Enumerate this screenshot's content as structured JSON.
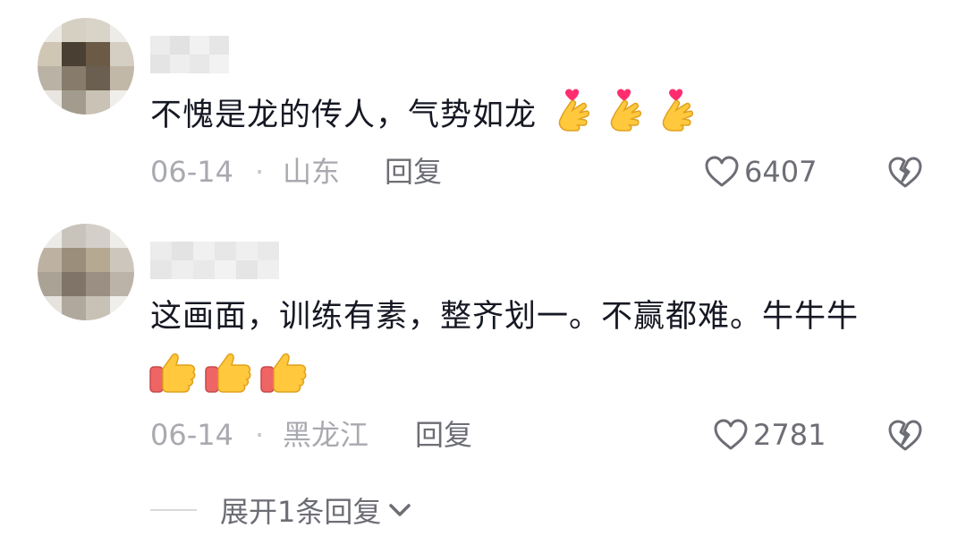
{
  "comments": [
    {
      "text": "不愧是龙的传人，气势如龙",
      "emojis": [
        "finger-heart-icon",
        "finger-heart-icon",
        "finger-heart-icon"
      ],
      "date": "06-14",
      "location": "山东",
      "reply_label": "回复",
      "likes": "6407"
    },
    {
      "text": "这画面，训练有素，整齐划一。不赢都难。牛牛牛",
      "emojis": [
        "thumbs-up-icon",
        "thumbs-up-icon",
        "thumbs-up-icon"
      ],
      "date": "06-14",
      "location": "黑龙江",
      "reply_label": "回复",
      "likes": "2781"
    }
  ],
  "separator": "·",
  "expand_replies": {
    "label": "展开1条回复"
  },
  "colors": {
    "text": "#161823",
    "meta": "#a9aab0",
    "action": "#6d6e75",
    "heart_pink": "#ff2d6f",
    "emoji_yellow": "#ffc83d",
    "sleeve": "#ef6464"
  }
}
